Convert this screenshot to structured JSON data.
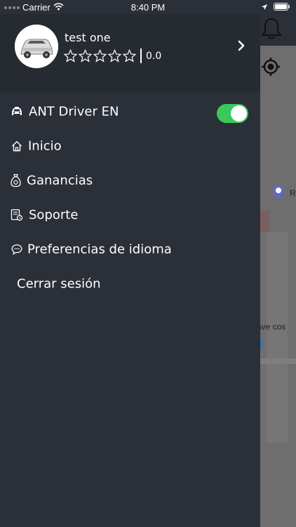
{
  "status_bar": {
    "carrier": "Carrier",
    "time": "8:40 PM"
  },
  "profile": {
    "name": "test one",
    "rating_value": "0.0",
    "stars_filled": 0,
    "stars_total": 5
  },
  "menu": {
    "items": [
      {
        "label": "ANT Driver EN",
        "icon": "car-icon"
      },
      {
        "label": "Inicio",
        "icon": "home-icon"
      },
      {
        "label": "Ganancias",
        "icon": "money-bag-icon"
      },
      {
        "label": "Soporte",
        "icon": "support-icon"
      },
      {
        "label": "Preferencias de idioma",
        "icon": "chat-icon"
      },
      {
        "label": "Cerrar sesión",
        "icon": ""
      }
    ],
    "driver_toggle_on": true
  },
  "map": {
    "labels": [
      "R",
      "ave cos"
    ]
  },
  "colors": {
    "drawer_bg": "#2b2f37",
    "profile_bg": "#262a31",
    "toggle_on": "#3ac95b"
  }
}
